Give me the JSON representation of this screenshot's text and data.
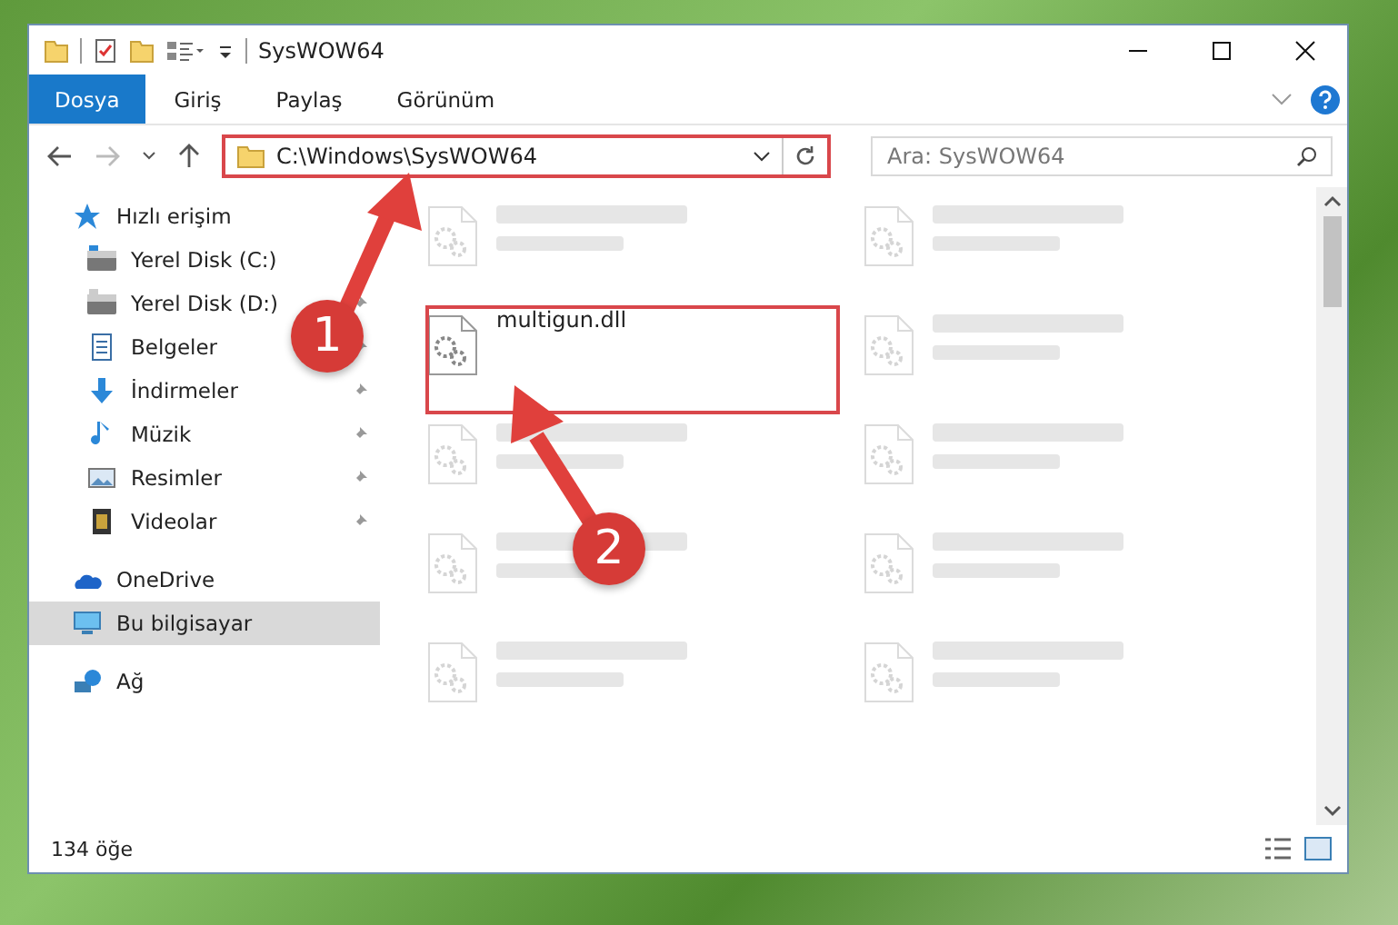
{
  "window": {
    "title": "SysWOW64"
  },
  "ribbon_tabs": [
    {
      "label": "Dosya",
      "selected": true
    },
    {
      "label": "Giriş",
      "selected": false
    },
    {
      "label": "Paylaş",
      "selected": false
    },
    {
      "label": "Görünüm",
      "selected": false
    }
  ],
  "address": {
    "path": "C:\\Windows\\SysWOW64"
  },
  "search": {
    "placeholder": "Ara: SysWOW64"
  },
  "sidebar": {
    "items": [
      {
        "label": "Hızlı erişim",
        "kind": "star",
        "pinned": false,
        "selected": false,
        "children": [
          {
            "label": "Yerel Disk (C:)",
            "kind": "drive",
            "pinned": false,
            "selected": false
          },
          {
            "label": "Yerel Disk (D:)",
            "kind": "drive",
            "pinned": true,
            "selected": false
          },
          {
            "label": "Belgeler",
            "kind": "doc",
            "pinned": true,
            "selected": false
          },
          {
            "label": "İndirmeler",
            "kind": "download",
            "pinned": true,
            "selected": false
          },
          {
            "label": "Müzik",
            "kind": "music",
            "pinned": true,
            "selected": false
          },
          {
            "label": "Resimler",
            "kind": "picture",
            "pinned": true,
            "selected": false
          },
          {
            "label": "Videolar",
            "kind": "video",
            "pinned": true,
            "selected": false
          }
        ]
      },
      {
        "label": "OneDrive",
        "kind": "cloud",
        "pinned": false,
        "selected": false
      },
      {
        "label": "Bu bilgisayar",
        "kind": "pc",
        "pinned": false,
        "selected": true
      },
      {
        "label": "Ağ",
        "kind": "network",
        "pinned": false,
        "selected": false
      }
    ]
  },
  "files": [
    {
      "faded": true
    },
    {
      "faded": true
    },
    {
      "name": "multigun.dll",
      "faded": false
    },
    {
      "faded": true
    },
    {
      "faded": true
    },
    {
      "faded": true
    },
    {
      "faded": true
    },
    {
      "faded": true
    },
    {
      "faded": true
    },
    {
      "faded": true
    }
  ],
  "callouts": [
    "1",
    "2"
  ],
  "status_bar": {
    "count": "134 öğe"
  }
}
